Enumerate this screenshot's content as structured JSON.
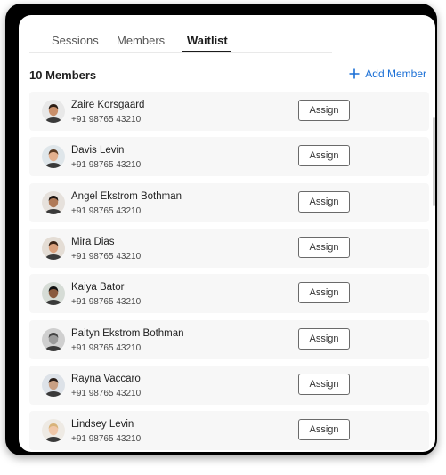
{
  "tabs": [
    {
      "label": "Sessions",
      "active": false
    },
    {
      "label": "Members",
      "active": false
    },
    {
      "label": "Waitlist",
      "active": true
    }
  ],
  "header": {
    "members_count": "10 Members",
    "add_member_label": "Add Member",
    "add_member_icon": "plus-icon"
  },
  "colors": {
    "accent": "#1a6fd6",
    "row_bg": "#f7f7f7"
  },
  "members": [
    {
      "name": "Zaire Korsgaard",
      "phone": "+91 98765 43210",
      "action": "Assign"
    },
    {
      "name": "Davis Levin",
      "phone": "+91 98765 43210",
      "action": "Assign"
    },
    {
      "name": "Angel Ekstrom Bothman",
      "phone": "+91 98765 43210",
      "action": "Assign"
    },
    {
      "name": "Mira Dias",
      "phone": "+91 98765 43210",
      "action": "Assign"
    },
    {
      "name": "Kaiya Bator",
      "phone": "+91 98765 43210",
      "action": "Assign"
    },
    {
      "name": "Paityn Ekstrom Bothman",
      "phone": "+91 98765 43210",
      "action": "Assign"
    },
    {
      "name": "Rayna Vaccaro",
      "phone": "+91 98765 43210",
      "action": "Assign"
    },
    {
      "name": "Lindsey Levin",
      "phone": "+91 98765 43210",
      "action": "Assign"
    }
  ]
}
